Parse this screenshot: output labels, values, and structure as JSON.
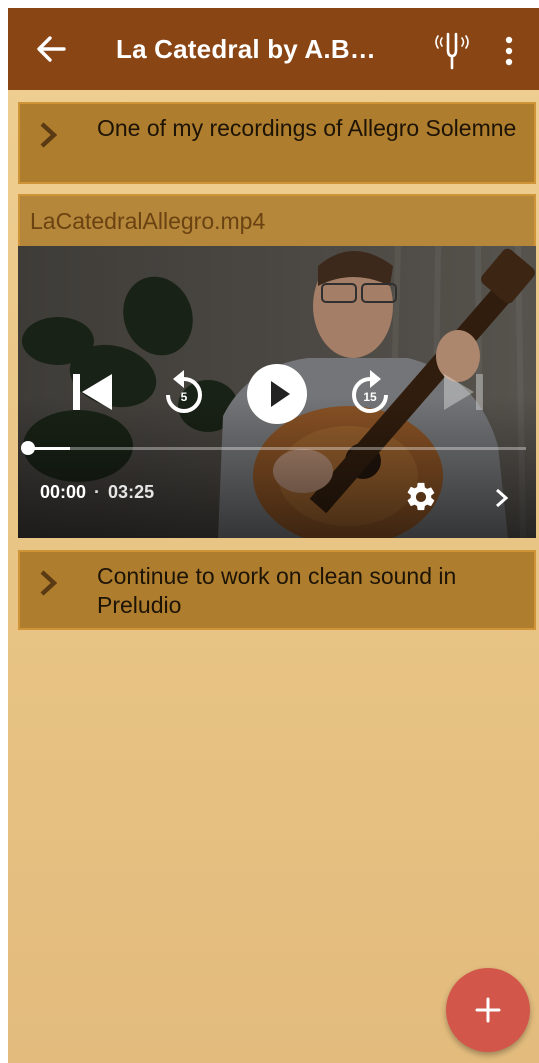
{
  "header": {
    "title": "La Catedral by A.B…",
    "back_icon": "arrow-left-icon",
    "tuner_icon": "tuning-fork-icon",
    "menu_icon": "more-vert-icon"
  },
  "notes": [
    {
      "label": "One of my recordings of Allegro Solemne"
    },
    {
      "label": "Continue to work on clean sound in Preludio"
    }
  ],
  "attachment": {
    "file_name": "LaCatedralAllegro.mp4"
  },
  "player": {
    "current_time": "00:00",
    "separator": "·",
    "duration": "03:25",
    "rewind_seconds": "5",
    "forward_seconds": "15",
    "progress_fraction": 0.0
  },
  "fab": {
    "label": "+"
  },
  "colors": {
    "appbar": "#8a4514",
    "note_bg": "#ae7d2d",
    "fab": "#d2574a"
  }
}
